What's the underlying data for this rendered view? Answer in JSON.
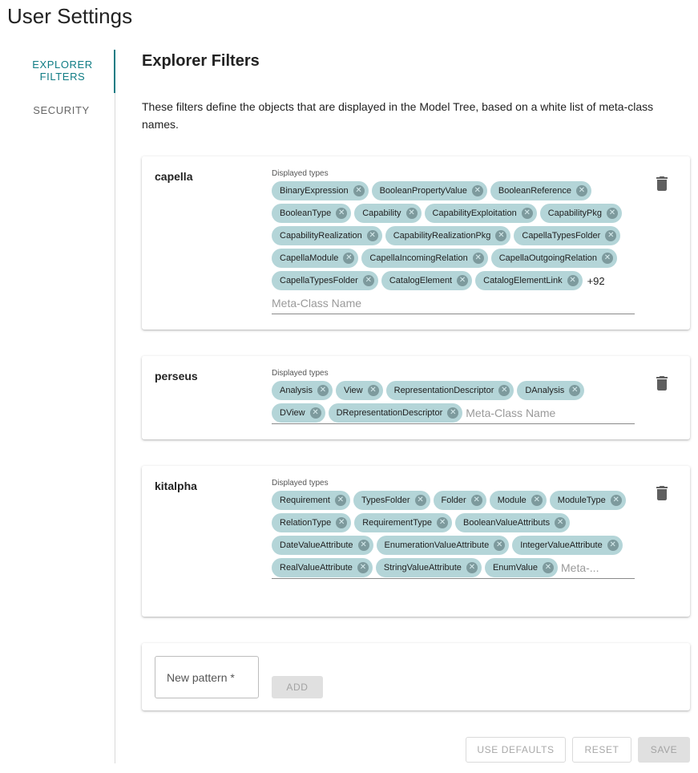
{
  "page": {
    "title": "User Settings"
  },
  "sidebar": {
    "items": [
      {
        "label": "EXPLORER FILTERS",
        "active": true
      },
      {
        "label": "SECURITY",
        "active": false
      }
    ]
  },
  "main": {
    "title": "Explorer Filters",
    "description": "These filters define the objects that are displayed in the Model Tree, based on a white list of meta-class names."
  },
  "filters": [
    {
      "name": "capella",
      "field_label": "Displayed types",
      "chips": [
        "BinaryExpression",
        "BooleanPropertyValue",
        "BooleanReference",
        "BooleanType",
        "Capability",
        "CapabilityExploitation",
        "CapabilityPkg",
        "CapabilityRealization",
        "CapabilityRealizationPkg",
        "CapellaTypesFolder",
        "CapellaModule",
        "CapellaIncomingRelation",
        "CapellaOutgoingRelation",
        "CapellaTypesFolder",
        "CatalogElement",
        "CatalogElementLink"
      ],
      "more_count": "+92",
      "placeholder": "Meta-Class Name"
    },
    {
      "name": "perseus",
      "field_label": "Displayed types",
      "chips": [
        "Analysis",
        "View",
        "RepresentationDescriptor",
        "DAnalysis",
        "DView",
        "DRepresentationDescriptor"
      ],
      "more_count": "",
      "placeholder": "Meta-Class Name"
    },
    {
      "name": "kitalpha",
      "field_label": "Displayed types",
      "chips": [
        "Requirement",
        "TypesFolder",
        "Folder",
        "Module",
        "ModuleType",
        "RelationType",
        "RequirementType",
        "BooleanValueAttributs",
        "DateValueAttribute",
        "EnumerationValueAttribute",
        "IntegerValueAttribute",
        "RealValueAttribute",
        "StringValueAttribute",
        "EnumValue"
      ],
      "more_count": "",
      "placeholder": "Meta-..."
    }
  ],
  "new_pattern": {
    "placeholder": "New pattern *",
    "value": "",
    "add_label": "ADD"
  },
  "actions": {
    "use_defaults": "USE DEFAULTS",
    "reset": "RESET",
    "save": "SAVE"
  },
  "colors": {
    "accent": "#0f7c84",
    "chip": "#b4d5d8",
    "chip_delete": "#7d9a9d"
  },
  "icons": {
    "chip_delete": "cancel-circle-icon",
    "delete_filter": "trash-icon"
  }
}
